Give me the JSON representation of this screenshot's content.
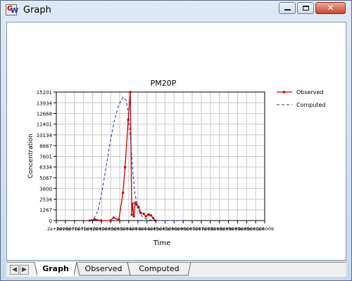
{
  "window": {
    "title": "Graph",
    "icon": "graph-app-icon"
  },
  "tabs": [
    {
      "label": "Graph",
      "active": true
    },
    {
      "label": "Observed",
      "active": false
    },
    {
      "label": "Computed",
      "active": false
    }
  ],
  "chart_data": {
    "type": "line",
    "title": "PM20P",
    "xlabel": "Time",
    "ylabel": "Concentration",
    "grid": true,
    "legend_position": "top-right",
    "xlim": [
      0,
      1000000000
    ],
    "ylim": [
      0,
      15201
    ],
    "x_tick_labels": [
      "2e+002",
      "2e+007",
      "6e+007",
      "1e+008",
      "1e+008",
      "2e+008",
      "2e+008",
      "3e+008",
      "3e+008",
      "4e+008",
      "4e+008",
      "4e+008",
      "5e+008",
      "5e+008",
      "6e+008",
      "6e+008",
      "7e+008",
      "7e+008",
      "8e+008",
      "8e+008",
      "9e+008",
      "9e+008",
      "9e+008",
      "1e+009"
    ],
    "x_tick_labels_visible": [
      "2e+002",
      "2e+007",
      "6e+007",
      "1e+008",
      "1e+008",
      "2e+008",
      "2e+008",
      "3e+008",
      "3e+008",
      "4e+008",
      "4e+008",
      "4e+008",
      "5e+008",
      "5e+008",
      "6e+008",
      "6e+008",
      "7e+008",
      "7e+008",
      "8e+008",
      "8e+008",
      "9e+008",
      "9e+008",
      "9e+008",
      "1e+009"
    ],
    "y_ticks": [
      0,
      1267,
      2534,
      3800,
      5067,
      6334,
      7601,
      8867,
      10134,
      11401,
      12668,
      13934,
      15201
    ],
    "series": [
      {
        "name": "Observed",
        "color": "#c00000",
        "style": "solid",
        "markers": true,
        "x": [
          160000000,
          185000000,
          215000000,
          260000000,
          275000000,
          300000000,
          320000000,
          330000000,
          345000000,
          355000000,
          362000000,
          365000000,
          372000000,
          378000000,
          385000000,
          395000000,
          405000000,
          420000000,
          430000000,
          440000000,
          445000000,
          455000000,
          465000000,
          475000000
        ],
        "y": [
          0,
          150,
          0,
          0,
          350,
          100,
          3300,
          6300,
          11900,
          15201,
          700,
          2000,
          500,
          2100,
          1900,
          1600,
          900,
          800,
          500,
          700,
          700,
          600,
          300,
          0
        ]
      },
      {
        "name": "Computed",
        "color": "#1a2ea0",
        "style": "dashed",
        "markers": false,
        "x": [
          160000000,
          180000000,
          200000000,
          220000000,
          240000000,
          260000000,
          280000000,
          300000000,
          320000000,
          335000000,
          345000000,
          355000000,
          365000000,
          375000000,
          390000000,
          405000000,
          420000000,
          440000000,
          460000000,
          500000000,
          550000000,
          600000000
        ],
        "y": [
          0,
          200,
          1200,
          3500,
          6500,
          9500,
          12000,
          13700,
          14600,
          14200,
          12800,
          10000,
          6500,
          3500,
          1600,
          700,
          300,
          100,
          30,
          0,
          0,
          0
        ]
      }
    ]
  }
}
